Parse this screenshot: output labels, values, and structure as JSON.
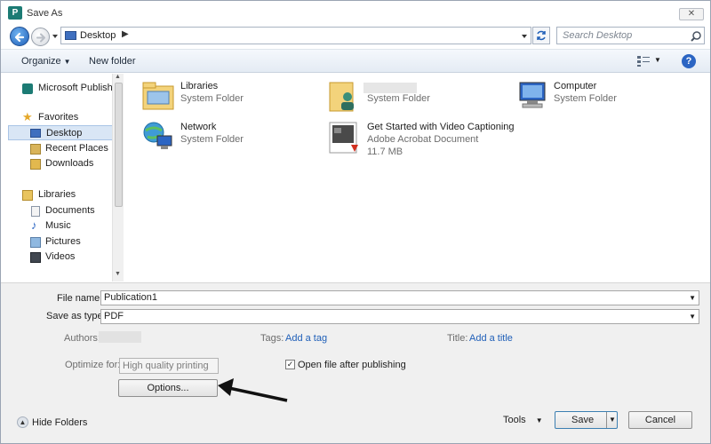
{
  "window": {
    "title": "Save As",
    "app_icon_letter": "P",
    "close_glyph": "✕"
  },
  "navbar": {
    "address": "Desktop",
    "address_chevron": "▶",
    "search_placeholder": "Search Desktop"
  },
  "toolbar": {
    "organize_label": "Organize",
    "new_folder_label": "New folder",
    "help_glyph": "?"
  },
  "sidebar": {
    "items": [
      {
        "label": "Microsoft Publisher",
        "icon": "publisher-icon"
      },
      {
        "label": "Favorites",
        "icon": "star-icon"
      },
      {
        "label": "Desktop",
        "icon": "desktop-icon",
        "selected": true
      },
      {
        "label": "Recent Places",
        "icon": "recent-places-icon"
      },
      {
        "label": "Downloads",
        "icon": "downloads-icon"
      },
      {
        "label": "Libraries",
        "icon": "libraries-icon"
      },
      {
        "label": "Documents",
        "icon": "documents-icon"
      },
      {
        "label": "Music",
        "icon": "music-icon"
      },
      {
        "label": "Pictures",
        "icon": "pictures-icon"
      },
      {
        "label": "Videos",
        "icon": "videos-icon"
      }
    ]
  },
  "files": [
    {
      "name": "Libraries",
      "type": "System Folder",
      "icon": "libraries-folder-icon"
    },
    {
      "name": "",
      "type": "System Folder",
      "icon": "user-folder-icon"
    },
    {
      "name": "Computer",
      "type": "System Folder",
      "icon": "computer-icon"
    },
    {
      "name": "Network",
      "type": "System Folder",
      "icon": "network-icon"
    },
    {
      "name": "Get Started with Video Captioning",
      "type": "Adobe Acrobat Document",
      "size": "11.7 MB",
      "icon": "pdf-document-icon"
    }
  ],
  "form": {
    "file_name_label": "File name:",
    "file_name_value": "Publication1",
    "save_type_label": "Save as type:",
    "save_type_value": "PDF",
    "authors_label": "Authors:",
    "tags_label": "Tags:",
    "tags_link": "Add a tag",
    "title_label": "Title:",
    "title_link": "Add a title",
    "optimize_label": "Optimize for:",
    "optimize_value": "High quality printing",
    "open_after_label": "Open file after publishing",
    "open_after_checked": "✓",
    "options_button": "Options...",
    "hide_folders_label": "Hide Folders",
    "tools_label": "Tools",
    "save_button": "Save",
    "cancel_button": "Cancel"
  }
}
